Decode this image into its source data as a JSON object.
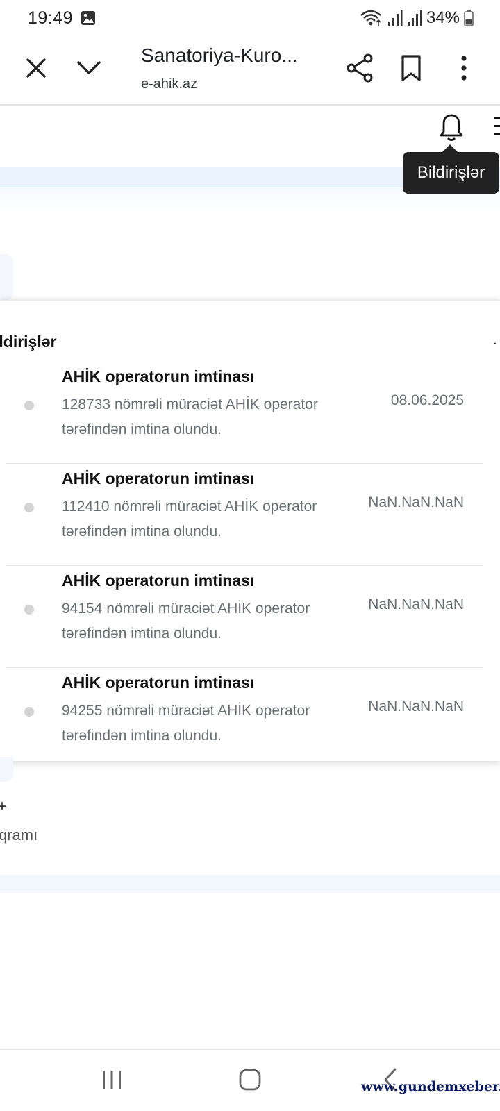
{
  "status_bar": {
    "time": "19:49",
    "battery": "34%",
    "icons": [
      "gallery-icon",
      "wifi-icon",
      "signal-icon",
      "signal-icon",
      "battery-icon"
    ]
  },
  "browser": {
    "title": "Sanatoriya-Kuro...",
    "url": "e-ahik.az",
    "icons": [
      "close-icon",
      "chevron-down-icon",
      "share-icon",
      "bookmark-icon",
      "more-vert-icon"
    ]
  },
  "site": {
    "tooltip": "Bildirişlər",
    "icons": [
      "bell-icon",
      "hamburger-icon"
    ]
  },
  "notifications": {
    "heading": "ildirişlər",
    "more": ".",
    "items": [
      {
        "title": "AHİK operatorun imtinası",
        "text": "128733 nömrəli müraciət AHİK operator tərəfindən imtina olundu.",
        "date": "08.06.2025"
      },
      {
        "title": "AHİK operatorun imtinası",
        "text": "112410 nömrəli müraciət AHİK operator tərəfindən imtina olundu.",
        "date": "NaN.NaN.NaN"
      },
      {
        "title": "AHİK operatorun imtinası",
        "text": "94154 nömrəli müraciət AHİK operator tərəfindən imtina olundu.",
        "date": "NaN.NaN.NaN"
      },
      {
        "title": "AHİK operatorun imtinası",
        "text": "94255 nömrəli müraciət AHİK operator tərəfindən imtina olundu.",
        "date": "NaN.NaN.NaN"
      }
    ]
  },
  "page_behind": {
    "plus": "+",
    "program": "qramı"
  },
  "nav": {
    "icons": [
      "recent-apps-icon",
      "home-icon",
      "back-icon"
    ]
  },
  "watermark": "www.gundemxeber.az"
}
